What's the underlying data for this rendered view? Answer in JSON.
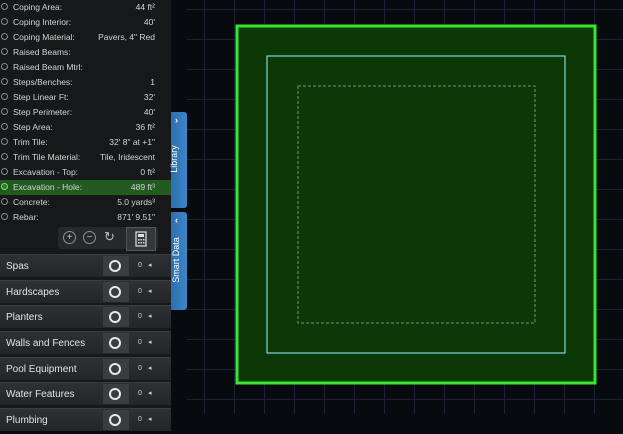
{
  "properties": [
    {
      "label": "Coping Area:",
      "value": "44 ft²"
    },
    {
      "label": "Coping Interior:",
      "value": "40'"
    },
    {
      "label": "Coping Material:",
      "value": "Pavers, 4\" Red"
    },
    {
      "label": "Raised Beams:",
      "value": ""
    },
    {
      "label": "Raised Beam Mtrl:",
      "value": ""
    },
    {
      "label": "Steps/Benches:",
      "value": "1"
    },
    {
      "label": "Step Linear Ft:",
      "value": "32'"
    },
    {
      "label": "Step Perimeter:",
      "value": "40'"
    },
    {
      "label": "Step Area:",
      "value": "36 ft²"
    },
    {
      "label": "Trim Tile:",
      "value": "32' 8\" at +1\""
    },
    {
      "label": "Trim Tile Material:",
      "value": "Tile, Iridescent"
    },
    {
      "label": "Excavation - Top:",
      "value": "0 ft²"
    },
    {
      "label": "Excavation - Hole:",
      "value": "489 ft³"
    },
    {
      "label": "Concrete:",
      "value": "5.0 yards³"
    },
    {
      "label": "Rebar:",
      "value": "871' 9.51\""
    }
  ],
  "highlighted_index": 12,
  "tools": {
    "zoom_in": "+",
    "zoom_out": "−",
    "refresh": "↻"
  },
  "categories": [
    {
      "label": "Spas",
      "count": "0"
    },
    {
      "label": "Hardscapes",
      "count": "0"
    },
    {
      "label": "Planters",
      "count": "0"
    },
    {
      "label": "Walls and Fences",
      "count": "0"
    },
    {
      "label": "Pool Equipment",
      "count": "0"
    },
    {
      "label": "Water Features",
      "count": "0"
    },
    {
      "label": "Plumbing",
      "count": "0"
    }
  ],
  "side_tabs": {
    "library": "Library",
    "smart_data": "Smart Data",
    "arrow_right": "›",
    "arrow_left": "‹"
  },
  "cat_arrow": "◂",
  "colors": {
    "outer_outline": "#39e62c",
    "pool_fill": "#0c3807",
    "inner_outline": "#7fd6d4",
    "dashed_outline": "#6e9a6c",
    "highlight_row": "#235a22",
    "tab_blue": "#3479bb"
  }
}
